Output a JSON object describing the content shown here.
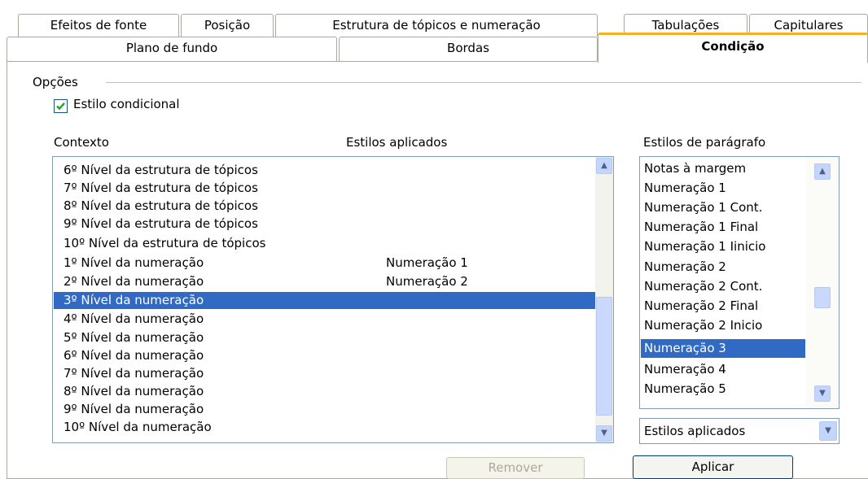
{
  "tabs_row1": [
    "Efeitos de fonte",
    "Posição",
    "Estrutura de tópicos e numeração",
    "Tabulações",
    "Capitulares"
  ],
  "tabs_row2": [
    "Plano de fundo",
    "Bordas",
    "Condição"
  ],
  "options": {
    "group_label": "Opções",
    "conditional_style_label": "Estilo condicional",
    "conditional_style_checked": true
  },
  "columns": {
    "context": "Contexto",
    "applied_styles": "Estilos aplicados",
    "paragraph_styles": "Estilos de parágrafo"
  },
  "context_rows": [
    {
      "context": "6º Nível da estrutura de tópicos",
      "style": ""
    },
    {
      "context": "7º Nível da estrutura de tópicos",
      "style": ""
    },
    {
      "context": "8º Nível da estrutura de tópicos",
      "style": ""
    },
    {
      "context": "9º Nível da estrutura de tópicos",
      "style": ""
    },
    {
      "context": "10º Nível da estrutura de tópicos",
      "style": ""
    },
    {
      "context": "1º Nível da numeração",
      "style": "Numeração 1"
    },
    {
      "context": "2º Nível da numeração",
      "style": "Numeração 2"
    },
    {
      "context": "3º Nível da numeração",
      "style": "",
      "selected": true
    },
    {
      "context": "4º Nível da numeração",
      "style": ""
    },
    {
      "context": "5º Nível da numeração",
      "style": ""
    },
    {
      "context": "6º Nível da numeração",
      "style": ""
    },
    {
      "context": "7º Nível da numeração",
      "style": ""
    },
    {
      "context": "8º Nível da numeração",
      "style": ""
    },
    {
      "context": "9º Nível da numeração",
      "style": ""
    },
    {
      "context": "10º Nível da numeração",
      "style": ""
    }
  ],
  "paragraph_style_items": [
    {
      "label": "Notas à margem"
    },
    {
      "label": "Numeração 1"
    },
    {
      "label": "Numeração 1 Cont."
    },
    {
      "label": "Numeração 1 Final"
    },
    {
      "label": "Numeração 1 Iinicio"
    },
    {
      "label": "Numeração 2"
    },
    {
      "label": "Numeração 2 Cont."
    },
    {
      "label": "Numeração 2 Final"
    },
    {
      "label": "Numeração 2 Inicio"
    },
    {
      "label": "Numeração 3",
      "selected": true
    },
    {
      "label": "Numeração 4"
    },
    {
      "label": "Numeração 5"
    }
  ],
  "style_filter": {
    "selected": "Estilos aplicados"
  },
  "buttons": {
    "remove": "Remover",
    "apply": "Aplicar"
  },
  "colors": {
    "selection": "#316ac5",
    "active_tab_accent": "#f5b026",
    "checkbox_check": "#21a121"
  }
}
